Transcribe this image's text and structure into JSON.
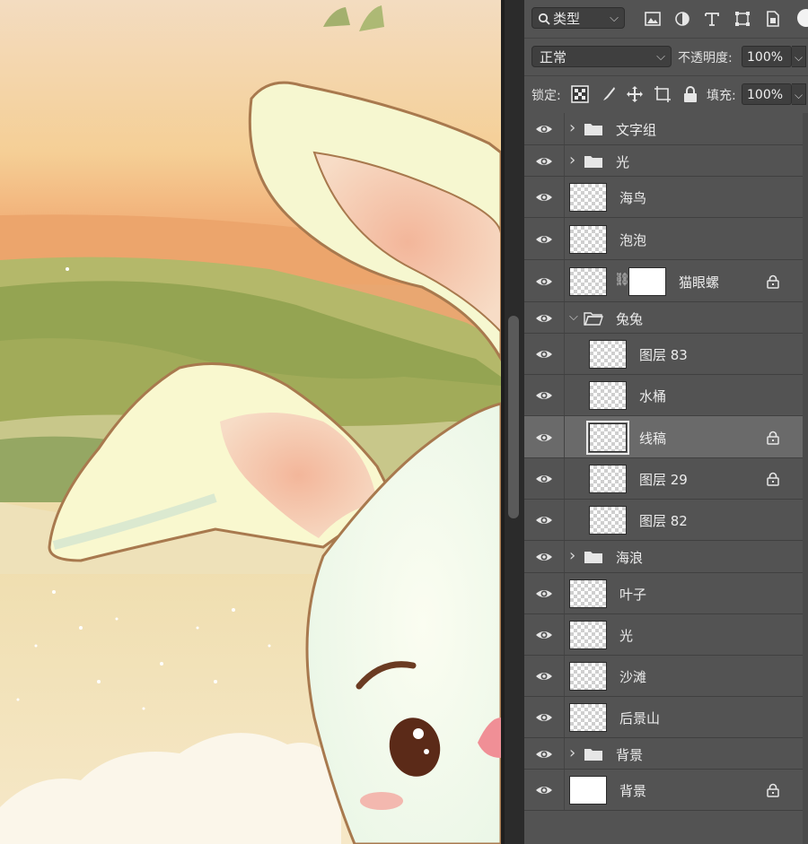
{
  "filter": {
    "kind_label": "类型",
    "icon": "search-icon"
  },
  "filter_icons": [
    "image-filter-icon",
    "adjustment-filter-icon",
    "type-filter-icon",
    "shape-filter-icon",
    "smart-object-filter-icon"
  ],
  "blend": {
    "mode": "正常",
    "opacity_label": "不透明度:",
    "opacity_value": "100%"
  },
  "lock": {
    "label": "锁定:",
    "fill_label": "填充:",
    "fill_value": "100%"
  },
  "layers": [
    {
      "name": "文字组",
      "type": "group",
      "expanded": false,
      "indent": 0,
      "locked": false
    },
    {
      "name": "光",
      "type": "group",
      "expanded": false,
      "indent": 0,
      "locked": false
    },
    {
      "name": "海鸟",
      "type": "layer",
      "indent": 0,
      "locked": false
    },
    {
      "name": "泡泡",
      "type": "layer",
      "indent": 0,
      "locked": false
    },
    {
      "name": "猫眼螺",
      "type": "layer",
      "mask": true,
      "indent": 0,
      "locked": true
    },
    {
      "name": "兔兔",
      "type": "group",
      "expanded": true,
      "indent": 0,
      "locked": false
    },
    {
      "name": "图层 83",
      "type": "layer",
      "indent": 1,
      "locked": false
    },
    {
      "name": "水桶",
      "type": "layer",
      "indent": 1,
      "locked": false
    },
    {
      "name": "线稿",
      "type": "layer",
      "indent": 1,
      "locked": true,
      "selected": true
    },
    {
      "name": "图层 29",
      "type": "layer",
      "indent": 1,
      "locked": true
    },
    {
      "name": "图层 82",
      "type": "layer",
      "indent": 1,
      "locked": false
    },
    {
      "name": "海浪",
      "type": "group",
      "expanded": false,
      "indent": 0,
      "locked": false
    },
    {
      "name": "叶子",
      "type": "layer",
      "indent": 0,
      "locked": false
    },
    {
      "name": "光",
      "type": "layer",
      "indent": 0,
      "locked": false
    },
    {
      "name": "沙滩",
      "type": "layer",
      "indent": 0,
      "locked": false
    },
    {
      "name": "后景山",
      "type": "layer",
      "indent": 0,
      "locked": false
    },
    {
      "name": "背景",
      "type": "group",
      "expanded": false,
      "indent": 0,
      "locked": false
    },
    {
      "name": "背景",
      "type": "layer",
      "white": true,
      "indent": 0,
      "locked": true
    }
  ]
}
